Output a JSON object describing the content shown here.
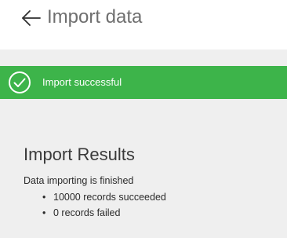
{
  "header": {
    "back_icon": "arrow-left-icon",
    "title": "Import data"
  },
  "banner": {
    "icon": "check-circle-icon",
    "message": "Import successful",
    "color": "#3db44a"
  },
  "results": {
    "title": "Import Results",
    "summary": "Data importing is finished",
    "items": [
      "10000 records succeeded",
      "0 records failed"
    ]
  }
}
